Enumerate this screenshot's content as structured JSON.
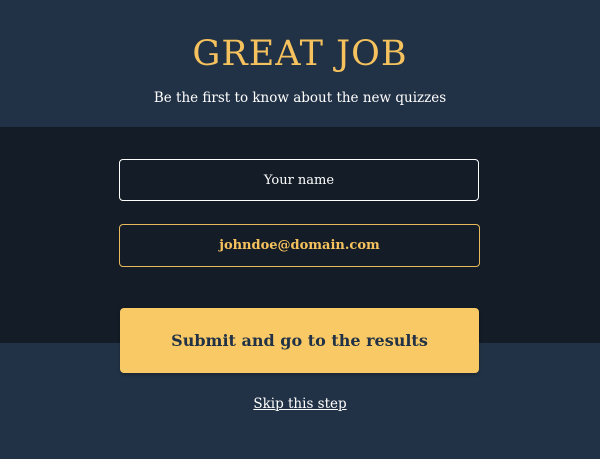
{
  "header": {
    "title": "GREAT JOB",
    "subtitle": "Be the first to know about the new quizzes"
  },
  "form": {
    "name_placeholder": "Your name",
    "email_value": "johndoe@domain.com",
    "submit_label": "Submit and go to the results",
    "skip_label": "Skip this step"
  },
  "colors": {
    "background": "#223246",
    "band": "#131c27",
    "accent": "#f6c25e",
    "button": "#f8c965",
    "text": "#ffffff"
  }
}
